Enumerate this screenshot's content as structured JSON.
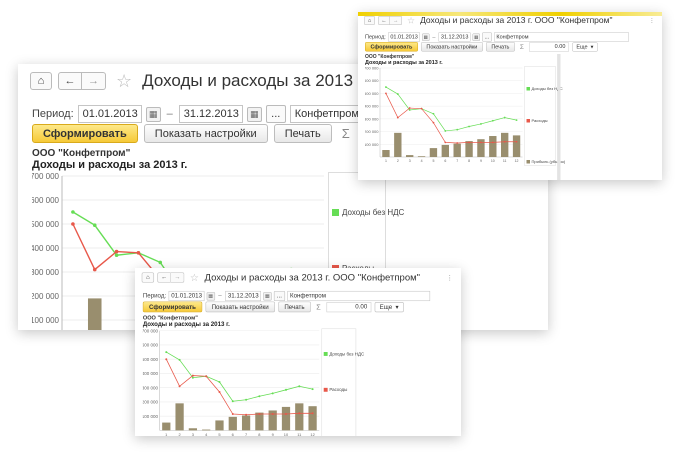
{
  "window": {
    "title": "Доходы и расходы за 2013 г. ООО \"Конфетпром\"",
    "home_icon": "home-icon",
    "back_icon": "arrow-left-icon",
    "forward_icon": "arrow-right-icon",
    "star_icon": "star-icon",
    "more_label": "⋮"
  },
  "filter": {
    "period_label": "Период:",
    "date_from": "01.01.2013",
    "separator": "–",
    "date_to": "31.12.2013",
    "ellipsis": "...",
    "organization": "Конфетпром"
  },
  "toolbar": {
    "generate_label": "Сформировать",
    "settings_label": "Показать настройки",
    "print_label": "Печать",
    "sigma": "Σ",
    "sum_value": "0.00",
    "more_label": "Еще"
  },
  "report": {
    "org_name": "ООО \"Конфетпром\"",
    "title": "Доходы и расходы за 2013 г."
  },
  "colors": {
    "income_line": "#66dd55",
    "expense_line": "#e8584a",
    "bars": "#998e6e",
    "accent": "#f6c938"
  },
  "chart_data": {
    "type": "bar",
    "categories": [
      "1",
      "2",
      "3",
      "4",
      "5",
      "6",
      "7",
      "8",
      "9",
      "10",
      "11",
      "12"
    ],
    "ylim": [
      0,
      700000
    ],
    "yticks": [
      "700 000",
      "600 000",
      "500 000",
      "400 000",
      "300 000",
      "200 000",
      "100 000"
    ],
    "series": [
      {
        "name": "Доходы без НДС",
        "kind": "line",
        "values": [
          550000,
          495000,
          370000,
          380000,
          340000,
          205000,
          215000,
          240000,
          260000,
          285000,
          310000,
          290000
        ]
      },
      {
        "name": "Расходы",
        "kind": "line",
        "values": [
          500000,
          310000,
          385000,
          380000,
          270000,
          115000,
          110000,
          115000,
          115000,
          115000,
          120000,
          120000
        ]
      },
      {
        "name": "Прибыль (убыток)",
        "kind": "bar",
        "values": [
          55000,
          190000,
          -15000,
          -5000,
          70000,
          95000,
          105000,
          125000,
          140000,
          165000,
          190000,
          170000
        ]
      }
    ]
  }
}
